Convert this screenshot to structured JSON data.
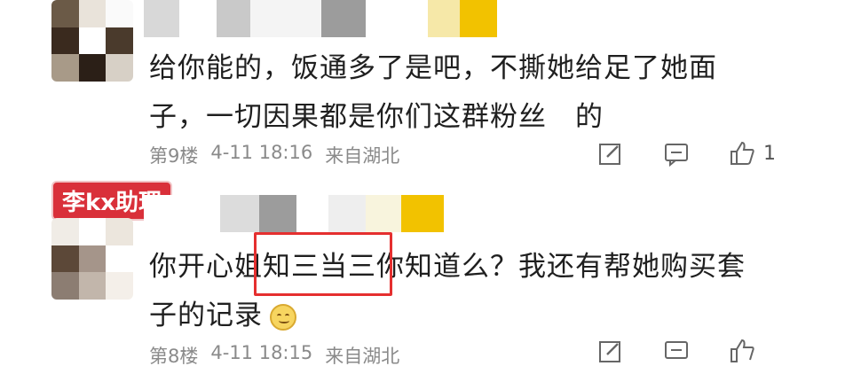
{
  "comments": [
    {
      "text_line1": "给你能的，饭通多了是吧，不撕她给足了她面",
      "text_line2": "子，一切因果都是你们这群粉丝　的",
      "floor": "第9楼",
      "date": "4-11 18:16",
      "location": "来自湖北",
      "like_count": "1"
    },
    {
      "badge": "李kx助理",
      "text_before_box": "你开心姐",
      "text_boxed": "知三当三",
      "text_after_box": "你知道么？我还有帮她购买套",
      "text_line2": "子的记录",
      "floor": "第8楼",
      "date": "4-11 18:15",
      "location": "来自湖北"
    }
  ],
  "icons": {
    "edit": "edit-icon",
    "reply": "reply-icon",
    "like": "thumb-up-icon"
  },
  "colors": {
    "highlight": "#e52f2f",
    "badge": "#d9303a",
    "meta_text": "#8a8a8a"
  }
}
